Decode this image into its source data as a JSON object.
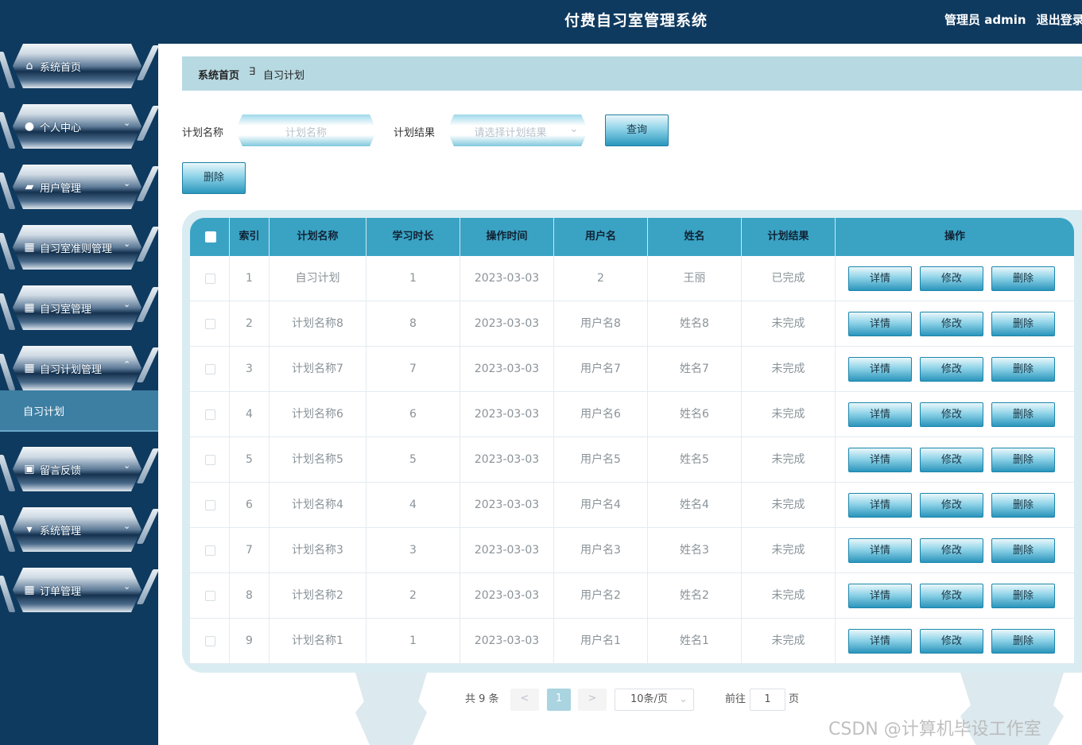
{
  "header": {
    "title": "付费自习室管理系统",
    "user": "管理员 admin",
    "logout": "退出登录"
  },
  "sidebar": {
    "items": [
      {
        "label": "系统首页",
        "icon": "home-icon",
        "glyph": "⌂",
        "caret": ""
      },
      {
        "label": "个人中心",
        "icon": "user-icon",
        "glyph": "●",
        "caret": "⌄"
      },
      {
        "label": "用户管理",
        "icon": "ticket-icon",
        "glyph": "▰",
        "caret": "⌄"
      },
      {
        "label": "自习室准则管理",
        "icon": "grid-icon",
        "glyph": "▦",
        "caret": "⌄"
      },
      {
        "label": "自习室管理",
        "icon": "grid-icon",
        "glyph": "▦",
        "caret": "⌄"
      },
      {
        "label": "自习计划管理",
        "icon": "grid-icon",
        "glyph": "▦",
        "caret": "⌃"
      },
      {
        "label": "留言反馈",
        "icon": "clipboard-icon",
        "glyph": "▣",
        "caret": "⌄"
      },
      {
        "label": "系统管理",
        "icon": "pin-icon",
        "glyph": "▾",
        "caret": "⌄"
      },
      {
        "label": "订单管理",
        "icon": "grid-icon",
        "glyph": "▦",
        "caret": "⌄"
      }
    ],
    "active_sub": "自习计划"
  },
  "breadcrumb": {
    "home": "系统首页",
    "separator": "∃",
    "current": "自习计划"
  },
  "search": {
    "name_label": "计划名称",
    "name_placeholder": "计划名称",
    "result_label": "计划结果",
    "result_placeholder": "请选择计划结果",
    "query_button": "查询",
    "delete_button": "删除"
  },
  "table": {
    "columns": [
      "索引",
      "计划名称",
      "学习时长",
      "操作时间",
      "用户名",
      "姓名",
      "计划结果",
      "操作"
    ],
    "actions": [
      "详情",
      "修改",
      "删除"
    ],
    "rows": [
      [
        "1",
        "自习计划",
        "1",
        "2023-03-03",
        "2",
        "王丽",
        "已完成"
      ],
      [
        "2",
        "计划名称8",
        "8",
        "2023-03-03",
        "用户名8",
        "姓名8",
        "未完成"
      ],
      [
        "3",
        "计划名称7",
        "7",
        "2023-03-03",
        "用户名7",
        "姓名7",
        "未完成"
      ],
      [
        "4",
        "计划名称6",
        "6",
        "2023-03-03",
        "用户名6",
        "姓名6",
        "未完成"
      ],
      [
        "5",
        "计划名称5",
        "5",
        "2023-03-03",
        "用户名5",
        "姓名5",
        "未完成"
      ],
      [
        "6",
        "计划名称4",
        "4",
        "2023-03-03",
        "用户名4",
        "姓名4",
        "未完成"
      ],
      [
        "7",
        "计划名称3",
        "3",
        "2023-03-03",
        "用户名3",
        "姓名3",
        "未完成"
      ],
      [
        "8",
        "计划名称2",
        "2",
        "2023-03-03",
        "用户名2",
        "姓名2",
        "未完成"
      ],
      [
        "9",
        "计划名称1",
        "1",
        "2023-03-03",
        "用户名1",
        "姓名1",
        "未完成"
      ]
    ]
  },
  "pagination": {
    "total": "共 9 条",
    "prev": "<",
    "current": "1",
    "next": ">",
    "page_size": "10条/页",
    "goto_label": "前往",
    "goto_value": "1",
    "page_unit": "页"
  },
  "watermark": "CSDN @计算机毕设工作室",
  "colors": {
    "sidebar": "#0f3a5f",
    "accent": "#3aa3c4",
    "breadcrumb": "#b7d9e2"
  }
}
